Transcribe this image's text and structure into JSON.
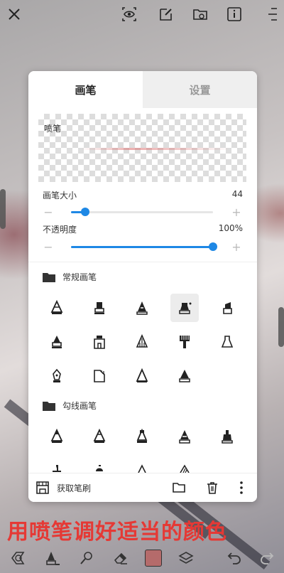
{
  "tabs": [
    {
      "label": "画笔"
    },
    {
      "label": "设置"
    }
  ],
  "preview": {
    "brush_name": "喷笔"
  },
  "brush_size": {
    "label": "画笔大小",
    "value": "44",
    "level": 0.1
  },
  "opacity": {
    "label": "不透明度",
    "value": "100%",
    "level": 1.0
  },
  "sections": [
    {
      "title": "常规画笔",
      "folder_icon": "folder-filled-icon"
    },
    {
      "title": "勾线画笔",
      "folder_icon": "folder-filled-icon"
    }
  ],
  "bottom_bar": {
    "get_brush_label": "获取笔刷"
  },
  "caption": "用喷笔调好适当的颜色",
  "colors": {
    "accent": "#1e88e5",
    "current_color": "#b56b6b",
    "caption": "#e53935"
  }
}
